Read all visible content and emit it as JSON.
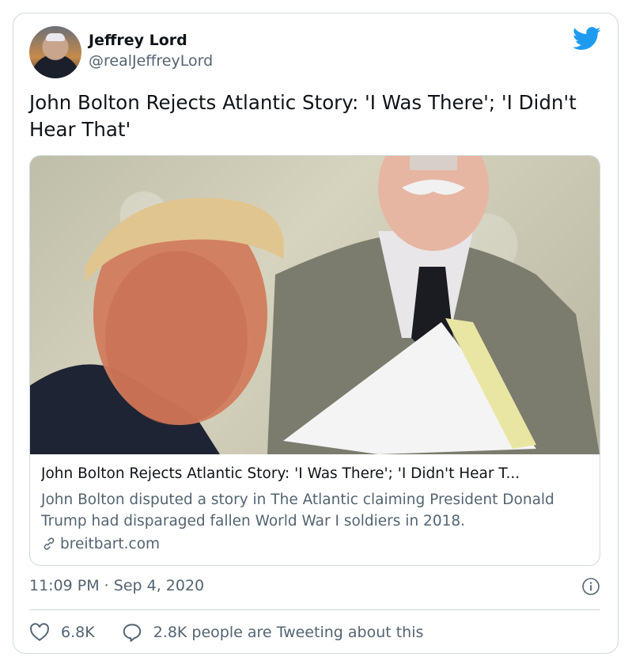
{
  "author": {
    "name": "Jeffrey Lord",
    "handle": "@realJeffreyLord"
  },
  "tweet": {
    "text": "John Bolton Rejects Atlantic Story: 'I Was There'; 'I Didn't Hear That'"
  },
  "link_card": {
    "title": "John Bolton Rejects Atlantic Story: 'I Was There'; 'I Didn't Hear T...",
    "description": "John Bolton disputed a story in The Atlantic claiming President Donald Trump had disparaged fallen World War I soldiers in 2018.",
    "domain": "breitbart.com"
  },
  "meta": {
    "timestamp": "11:09 PM · Sep 4, 2020"
  },
  "actions": {
    "like_count": "6.8K",
    "tweeting_text": "2.8K people are Tweeting about this"
  },
  "colors": {
    "twitter_blue": "#1d9bf0",
    "secondary_text": "#536471",
    "border": "#cfd9de"
  },
  "icons": [
    "twitter-bird-icon",
    "link-icon",
    "info-icon",
    "heart-icon",
    "speech-bubble-icon"
  ]
}
